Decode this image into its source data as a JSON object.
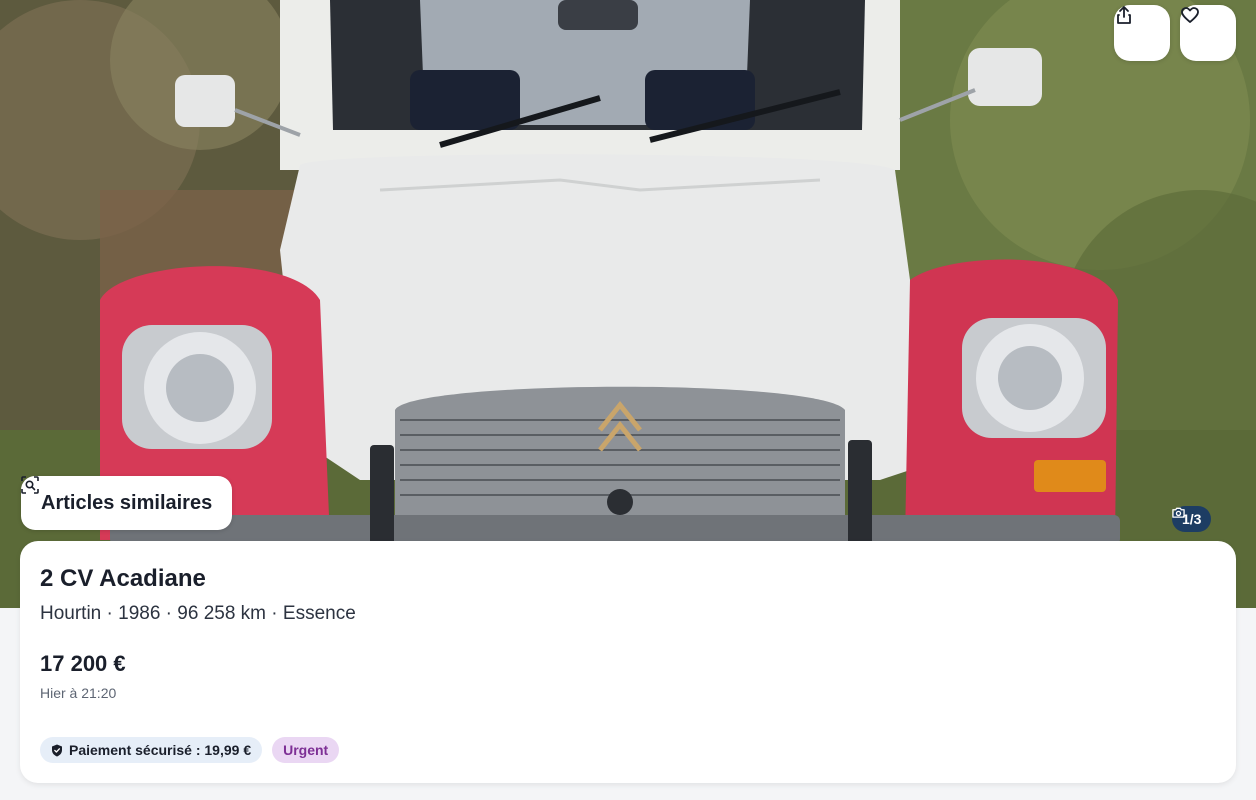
{
  "hero": {
    "photo_description_icon": "car-photo",
    "photo_counter": "1/3"
  },
  "actions": {
    "share_icon": "share-icon",
    "favorite_icon": "heart-icon",
    "similar_label": "Articles similaires",
    "similar_icon": "visual-search-icon"
  },
  "listing": {
    "title": "2 CV Acadiane",
    "meta": "Hourtin · 1986 · 96 258 km · Essence",
    "price": "17 200 €",
    "date": "Hier à 21:20",
    "badges": {
      "payment": "Paiement sécurisé : 19,99 €",
      "urgent": "Urgent"
    }
  },
  "colors": {
    "accent_dark_blue": "#1d3d63",
    "payment_badge_bg": "#e6eef8",
    "urgent_badge_bg": "#ead7f3",
    "urgent_badge_text": "#7d2f95"
  }
}
